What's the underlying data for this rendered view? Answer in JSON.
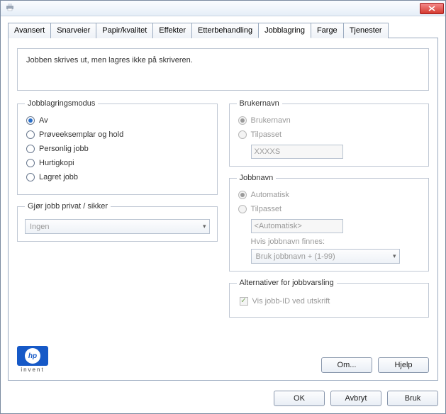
{
  "titlebar": {
    "icon": "printer-icon"
  },
  "tabs": [
    "Avansert",
    "Snarveier",
    "Papir/kvalitet",
    "Effekter",
    "Etterbehandling",
    "Jobblagring",
    "Farge",
    "Tjenester"
  ],
  "active_tab_index": 5,
  "info_text": "Jobben skrives ut, men lagres ikke på skriveren.",
  "storage_mode": {
    "legend": "Jobblagringsmodus",
    "options": [
      "Av",
      "Prøveeksemplar og hold",
      "Personlig jobb",
      "Hurtigkopi",
      "Lagret jobb"
    ],
    "selected_index": 0
  },
  "private": {
    "legend": "Gjør jobb privat / sikker",
    "value": "Ingen"
  },
  "username": {
    "legend": "Brukernavn",
    "opt_user": "Brukernavn",
    "opt_custom": "Tilpasset",
    "selected": "user",
    "value": "XXXXS"
  },
  "jobname": {
    "legend": "Jobbnavn",
    "opt_auto": "Automatisk",
    "opt_custom": "Tilpasset",
    "selected": "auto",
    "value": "<Automatisk>",
    "exists_label": "Hvis jobbnavn finnes:",
    "exists_value": "Bruk jobbnavn + (1-99)"
  },
  "notify": {
    "legend": "Alternativer for jobbvarsling",
    "checkbox_label": "Vis jobb-ID ved utskrift",
    "checked": true
  },
  "buttons": {
    "about": "Om...",
    "help": "Hjelp",
    "ok": "OK",
    "cancel": "Avbryt",
    "apply": "Bruk"
  },
  "logo": {
    "text": "hp",
    "sub": "invent"
  }
}
